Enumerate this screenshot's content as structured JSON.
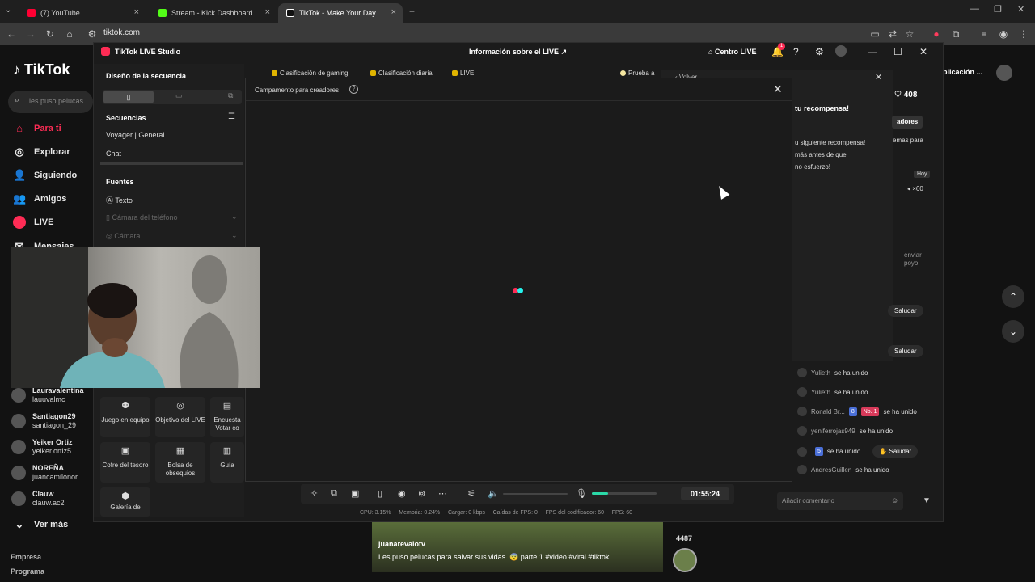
{
  "browser": {
    "tabs": [
      {
        "label": "(7) YouTube",
        "color": "#ff0033"
      },
      {
        "label": "Stream - Kick Dashboard",
        "color": "#53fc18"
      },
      {
        "label": "TikTok - Make Your Day",
        "color": "#ffffff"
      }
    ],
    "url": "tiktok.com"
  },
  "tiktok": {
    "logo": "TikTok",
    "search_placeholder": "les puso pelucas",
    "nav": [
      {
        "label": "Para ti",
        "icon": "home-icon",
        "active": true
      },
      {
        "label": "Explorar",
        "icon": "compass-icon"
      },
      {
        "label": "Siguiendo",
        "icon": "following-icon"
      },
      {
        "label": "Amigos",
        "icon": "friends-icon"
      },
      {
        "label": "LIVE",
        "icon": "live-icon"
      },
      {
        "label": "Mensajes",
        "icon": "message-icon"
      }
    ],
    "following": [
      {
        "name": "Lauravalentina",
        "handle": "lauuvalmc"
      },
      {
        "name": "Santiagon29",
        "handle": "santiagon_29"
      },
      {
        "name": "Yeiker Ortiz",
        "handle": "yeiker.ortiz5"
      },
      {
        "name": "NOREÑA",
        "handle": "juancamilonor"
      },
      {
        "name": "Clauw",
        "handle": "clauw.ac2"
      }
    ],
    "see_more": "Ver más",
    "footer": [
      "Empresa",
      "Programa"
    ],
    "app_button": "plicación ...",
    "likes_count": "408"
  },
  "studio": {
    "title": "TikTok LIVE Studio",
    "info": "Información sobre el LIVE",
    "centro": "Centro LIVE",
    "notif_count": "1",
    "left": {
      "design": "Diseño de la secuencia",
      "sequences": "Secuencias",
      "seq_items": [
        "Voyager | General",
        "Chat"
      ],
      "sources": "Fuentes",
      "source_items": [
        "Texto",
        "Cámara del teléfono",
        "Cámara"
      ]
    },
    "tools": [
      {
        "label": "Juego en equipo",
        "icon": "team-icon"
      },
      {
        "label": "Objetivo del LIVE",
        "icon": "target-icon"
      },
      {
        "label": "Encuesta Votar co",
        "icon": "poll-icon"
      },
      {
        "label": "Cofre del tesoro",
        "icon": "chest-icon"
      },
      {
        "label": "Bolsa de obsequios",
        "icon": "bag-icon"
      },
      {
        "label": "Guía",
        "icon": "guide-icon"
      },
      {
        "label": "Galería de",
        "icon": "gallery-icon"
      }
    ],
    "badges": [
      "Clasificación de gaming",
      "Clasificación diaria",
      "LIVE",
      "Prueba a"
    ],
    "modal": {
      "title": "Campamento para creadores"
    },
    "right": {
      "back_label": "Volver",
      "reward_title": "tu recompensa!",
      "creators_btn": "adores",
      "reward_text": [
        "u siguiente recompensa!",
        "más antes de que",
        "no esfuerzo!"
      ],
      "side_text": "emas para",
      "today": "Hoy",
      "gift_count": "×60",
      "send_text": [
        "enviar",
        "poyo."
      ]
    },
    "chat": [
      {
        "user": "Yulieth",
        "text": "se ha unido"
      },
      {
        "user": "Yulieth",
        "text": "se ha unido"
      },
      {
        "user": "Ronald Br...",
        "text": "se ha unido",
        "level": "8",
        "rank": "No. 1"
      },
      {
        "user": "yeniferrojas949",
        "text": "se ha unido"
      },
      {
        "user": "",
        "text": "se ha unido",
        "level": "5"
      },
      {
        "user": "AndresGuillen",
        "text": "se ha unido"
      }
    ],
    "salute": "Saludar",
    "comment_placeholder": "Añadir comentario",
    "timer": "01:55:24",
    "status": {
      "cpu": "CPU: 3.15%",
      "mem": "Memoria: 0.24%",
      "load": "Cargar: 0 kbps",
      "fps_drop": "Caídas de FPS: 0",
      "enc_fps": "FPS del codificador: 60",
      "fps": "FPS: 60"
    }
  },
  "video": {
    "user": "juanarevalotv",
    "caption": "Les puso pelucas para salvar sus vidas. 😨 parte 1 #video #viral #tiktok",
    "count": "4487"
  }
}
